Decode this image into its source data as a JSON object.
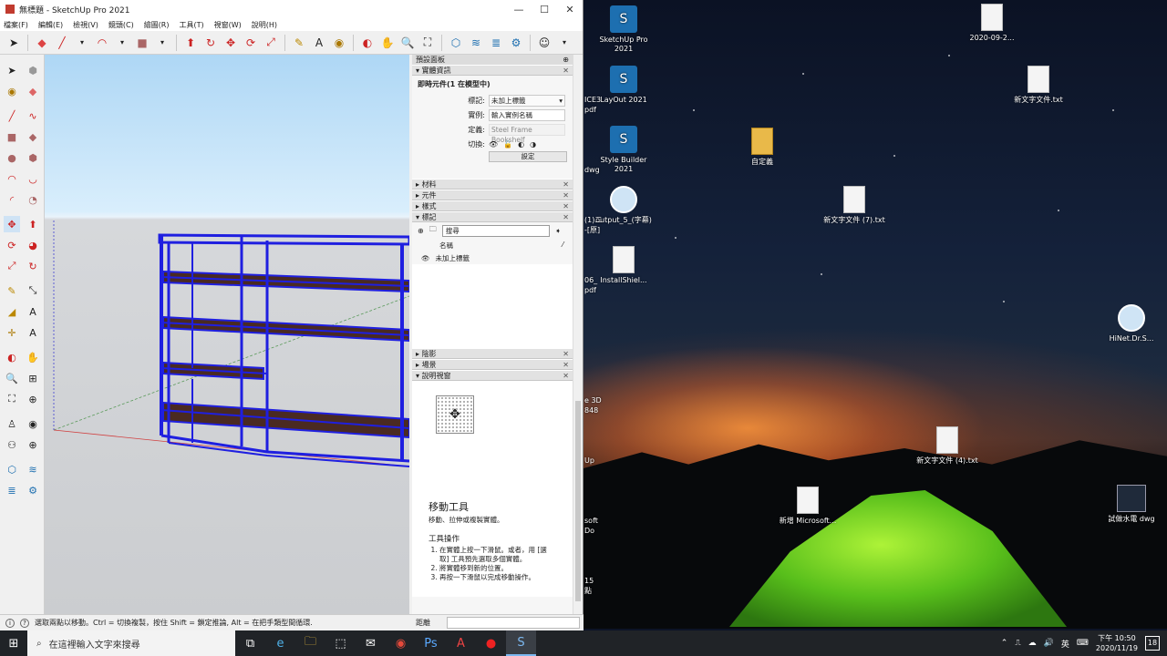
{
  "window": {
    "title": "無標題 - SketchUp Pro 2021",
    "minimize": "—",
    "maximize": "☐",
    "close": "✕"
  },
  "menu": [
    "檔案(F)",
    "編輯(E)",
    "檢視(V)",
    "鏡頭(C)",
    "繪圖(R)",
    "工具(T)",
    "視窗(W)",
    "說明(H)"
  ],
  "tray": {
    "title": "預設面板",
    "pin": "⊕",
    "entity_info": {
      "section": "實體資訊",
      "header": "即時元件(1 在模型中)",
      "tag_label": "標記:",
      "tag_value": "未加上標籤",
      "instance_label": "實例:",
      "instance_placeholder": "輸入實例名稱",
      "definition_label": "定義:",
      "definition_value": "Steel Frame Bookshelf",
      "toggles_label": "切換:",
      "settings_button": "設定"
    },
    "sections": {
      "materials": "材料",
      "components": "元件",
      "styles": "樣式",
      "tags": "標記",
      "shadows": "陰影",
      "scenes": "場景",
      "instructor": "說明視窗"
    },
    "tags": {
      "search_placeholder": "搜尋",
      "name_col": "名稱",
      "row_name": "未加上標籤"
    },
    "instructor": {
      "tool_title": "移動工具",
      "tool_desc": "移動、拉伸或複製實體。",
      "ops_title": "工具操作",
      "steps": [
        "在實體上按一下滑鼠。或者，用 [選取] 工具預先選取多個實體。",
        "將實體移到新的位置。",
        "再按一下滑鼠以完成移動操作。"
      ]
    }
  },
  "status": {
    "hint": "選取兩點以移動。Ctrl = 切換複製，按住 Shift = 鎖定推論, Alt = 在把手類型間循環.",
    "measure_label": "距離",
    "measure_value": ""
  },
  "desktop_icons": [
    {
      "label": "SketchUp Pro 2021",
      "kind": "su"
    },
    {
      "label": "LayOut 2021",
      "kind": "su"
    },
    {
      "label": "Style Builder 2021",
      "kind": "su"
    },
    {
      "label": "output_5_(字幕)",
      "kind": "round"
    },
    {
      "label": "InstallShiel...",
      "kind": "doc"
    },
    {
      "label": "2020-09-2...",
      "kind": "doc"
    },
    {
      "label": "新文字文件.txt",
      "kind": "doc"
    },
    {
      "label": "自定義",
      "kind": "folder"
    },
    {
      "label": "新文字文件 (7).txt",
      "kind": "doc"
    },
    {
      "label": "HiNet.Dr.S...",
      "kind": "round"
    },
    {
      "label": "新文字文件 (4).txt",
      "kind": "doc"
    },
    {
      "label": "新增 Microsoft...",
      "kind": "doc"
    },
    {
      "label": "試做水電 dwg",
      "kind": "dwg"
    }
  ],
  "edge_fragments": [
    "ICE3",
    "pdf",
    "(1)二",
    "-[原]",
    "dwg",
    "06_",
    "pdf",
    "e 3D",
    "848",
    "Up",
    "soft",
    "Do",
    "15",
    "點"
  ],
  "taskbar": {
    "search_placeholder": "在這裡輸入文字來搜尋",
    "ime": "英",
    "time": "下午 10:50",
    "date": "2020/11/19",
    "notif_count": "18"
  },
  "colors": {
    "frame": "#1f1fe0",
    "shelf": "#4a2a22",
    "sky": "#aed7f5",
    "ground": "#cbcdd0"
  }
}
